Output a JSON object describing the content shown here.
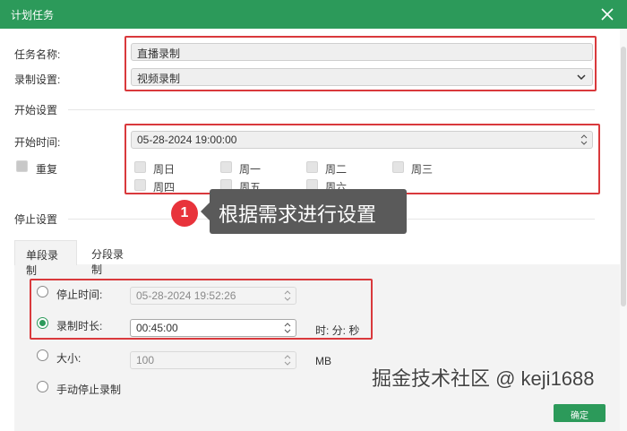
{
  "window": {
    "title": "计划任务"
  },
  "task": {
    "name_label": "任务名称:",
    "name_value": "直播录制",
    "record_label": "录制设置:",
    "record_value": "视频录制"
  },
  "start": {
    "section_title": "开始设置",
    "time_label": "开始时间:",
    "time_value": "05-28-2024 19:00:00",
    "repeat_label": "重复",
    "days": [
      "周日",
      "周一",
      "周二",
      "周三",
      "周四",
      "周五",
      "周六"
    ]
  },
  "stop": {
    "section_title": "停止设置",
    "tabs": [
      "单段录制",
      "分段录制"
    ],
    "stop_time_label": "停止时间:",
    "stop_time_value": "05-28-2024 19:52:26",
    "duration_label": "录制时长:",
    "duration_value": "00:45:00",
    "duration_unit": "时: 分: 秒",
    "size_label": "大小:",
    "size_value": "100",
    "size_unit": "MB",
    "manual_label": "手动停止录制"
  },
  "callout": {
    "number": "1",
    "text": "根据需求进行设置"
  },
  "watermark": "掘金技术社区 @ keji1688",
  "ok_button": "确定",
  "colors": {
    "brand": "#2c9a5a",
    "highlight": "#d9393c"
  }
}
